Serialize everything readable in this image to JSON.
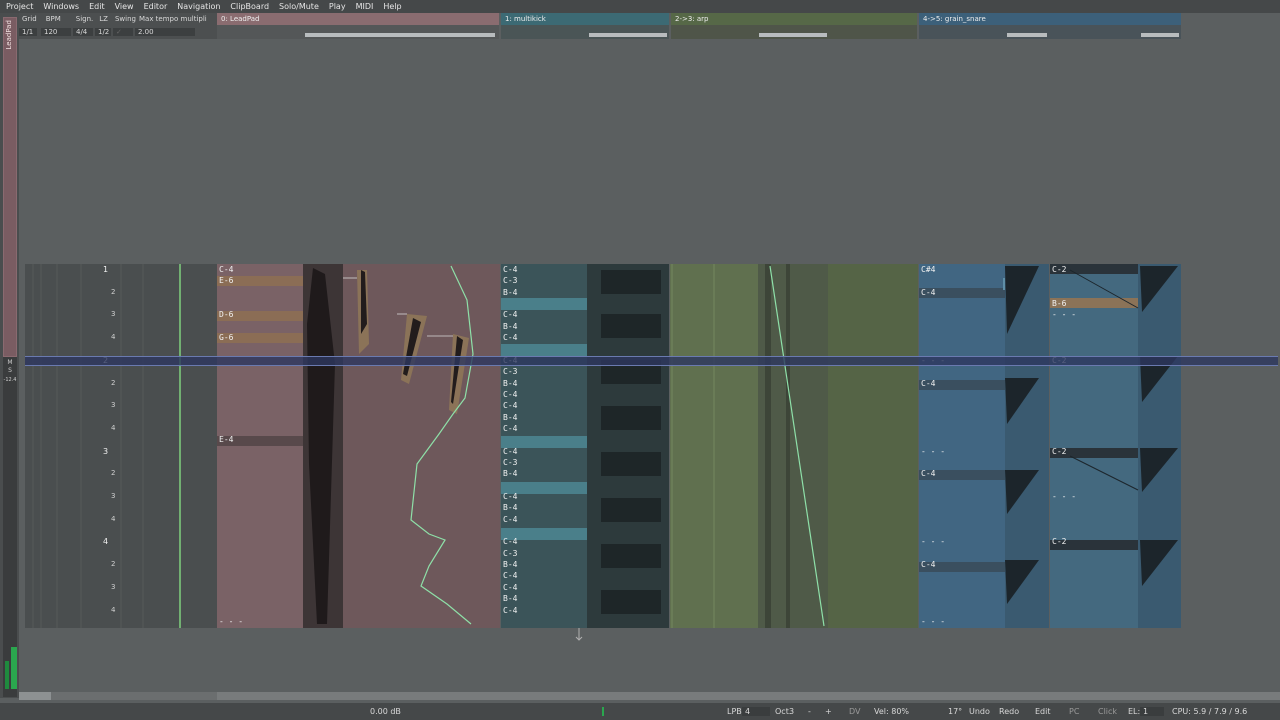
{
  "menu": [
    "Project",
    "Windows",
    "Edit",
    "View",
    "Editor",
    "Navigation",
    "ClipBoard",
    "Solo/Mute",
    "Play",
    "MIDI",
    "Help"
  ],
  "side": {
    "track_label": "LeadPad",
    "vu_m": "M",
    "vu_s": "S",
    "vu_db": "-12.4"
  },
  "settings": {
    "grid_label": "Grid",
    "bpm_label": "BPM",
    "sign_label": "Sign.",
    "lz_label": "LZ",
    "swing_label": "Swing",
    "maxtempo_label": "Max tempo multipli",
    "grid_value": "1/1",
    "bpm_value": "120",
    "sign_value": "4/4",
    "lz_value": "1/2",
    "swing_value": "✓",
    "maxtempo_value": "2.00"
  },
  "tracks": [
    {
      "label": "0:  LeadPad",
      "color": "#8a6c70"
    },
    {
      "label": "1:  multikick",
      "color": "#3c6a74"
    },
    {
      "label": "2->3:  arp",
      "color": "#566847"
    },
    {
      "label": "4->5:  grain_snare",
      "color": "#3c607a"
    }
  ],
  "beats": [
    {
      "label": "1",
      "bar": true
    },
    {
      "label": "2"
    },
    {
      "label": "3"
    },
    {
      "label": "4"
    },
    {
      "label": "2",
      "bar": true
    },
    {
      "label": "2"
    },
    {
      "label": "3"
    },
    {
      "label": "4"
    },
    {
      "label": "3",
      "bar": true
    },
    {
      "label": "2"
    },
    {
      "label": "3"
    },
    {
      "label": "4"
    },
    {
      "label": "4",
      "bar": true
    },
    {
      "label": "2"
    },
    {
      "label": "3"
    },
    {
      "label": "4"
    }
  ],
  "leadpad_notes": [
    {
      "row": 0,
      "text": "C-4"
    },
    {
      "row": 1,
      "text": "E-6"
    },
    {
      "row": 4,
      "text": "D-6"
    },
    {
      "row": 6,
      "text": "G-6"
    },
    {
      "row": 15,
      "text": "E-4"
    },
    {
      "row": 31,
      "text": "- - -"
    }
  ],
  "kick_notes": [
    {
      "row": 0,
      "text": "C-4"
    },
    {
      "row": 1,
      "text": "C-3"
    },
    {
      "row": 2,
      "text": "B-4"
    },
    {
      "row": 4,
      "text": "C-4"
    },
    {
      "row": 5,
      "text": "B-4"
    },
    {
      "row": 6,
      "text": "C-4"
    },
    {
      "row": 8,
      "text": "C-4"
    },
    {
      "row": 9,
      "text": "C-3"
    },
    {
      "row": 10,
      "text": "B-4"
    },
    {
      "row": 11,
      "text": "C-4"
    },
    {
      "row": 12,
      "text": "C-4"
    },
    {
      "row": 13,
      "text": "B-4"
    },
    {
      "row": 14,
      "text": "C-4"
    },
    {
      "row": 16,
      "text": "C-4"
    },
    {
      "row": 17,
      "text": "C-3"
    },
    {
      "row": 18,
      "text": "B-4"
    },
    {
      "row": 20,
      "text": "C-4"
    },
    {
      "row": 21,
      "text": "B-4"
    },
    {
      "row": 22,
      "text": "C-4"
    },
    {
      "row": 24,
      "text": "C-4"
    },
    {
      "row": 25,
      "text": "C-3"
    },
    {
      "row": 26,
      "text": "B-4"
    },
    {
      "row": 27,
      "text": "C-4"
    },
    {
      "row": 28,
      "text": "C-4"
    },
    {
      "row": 29,
      "text": "B-4"
    },
    {
      "row": 30,
      "text": "C-4"
    }
  ],
  "snare_notes": [
    {
      "row": 0,
      "text": "C#4"
    },
    {
      "row": 2,
      "text": "C-4"
    },
    {
      "row": 8,
      "text": "- - -"
    },
    {
      "row": 10,
      "text": "C-4"
    },
    {
      "row": 16,
      "text": "- - -"
    },
    {
      "row": 18,
      "text": "C-4"
    },
    {
      "row": 24,
      "text": "- - -"
    },
    {
      "row": 26,
      "text": "C-4"
    },
    {
      "row": 31,
      "text": "- - -"
    }
  ],
  "snare2_notes": [
    {
      "row": 0,
      "text": "C-2"
    },
    {
      "row": 3,
      "text": "B-6"
    },
    {
      "row": 4,
      "text": "- - -"
    },
    {
      "row": 8,
      "text": "C-2"
    },
    {
      "row": 16,
      "text": "C-2"
    },
    {
      "row": 20,
      "text": "- - -"
    },
    {
      "row": 24,
      "text": "C-2"
    }
  ],
  "status": {
    "db": "0.00 dB",
    "lpb_label": "LPB",
    "lpb_value": "4",
    "oct_label": "Oct.",
    "oct_value": "3",
    "minus": "-",
    "plus": "+",
    "dv": "DV",
    "vel": "Vel: 80%",
    "angle": "17°",
    "undo": "Undo",
    "redo": "Redo",
    "edit": "Edit",
    "pc": "PC",
    "click": "Click",
    "el_label": "EL:",
    "el_value": "1",
    "cpu": "CPU:  5.9  /  7.9  /  9.6"
  }
}
